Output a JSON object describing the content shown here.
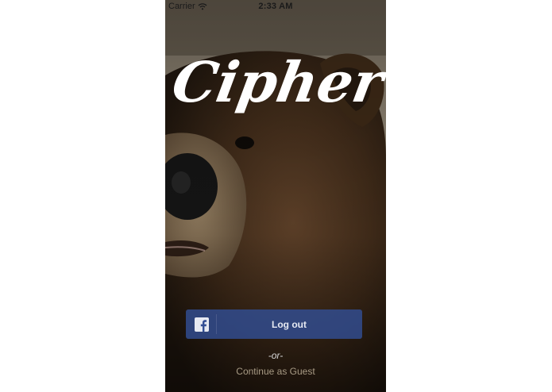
{
  "status_bar": {
    "carrier": "Carrier",
    "time": "2:33 AM"
  },
  "app": {
    "logo_text": "Cipher"
  },
  "login": {
    "button_label": "Log out",
    "button_icon": "facebook-icon",
    "or_text": "-or-",
    "guest_link": "Continue as Guest"
  },
  "colors": {
    "button_bg": "#324e94",
    "guest_link": "#a79a84",
    "logo": "#ffffff"
  }
}
